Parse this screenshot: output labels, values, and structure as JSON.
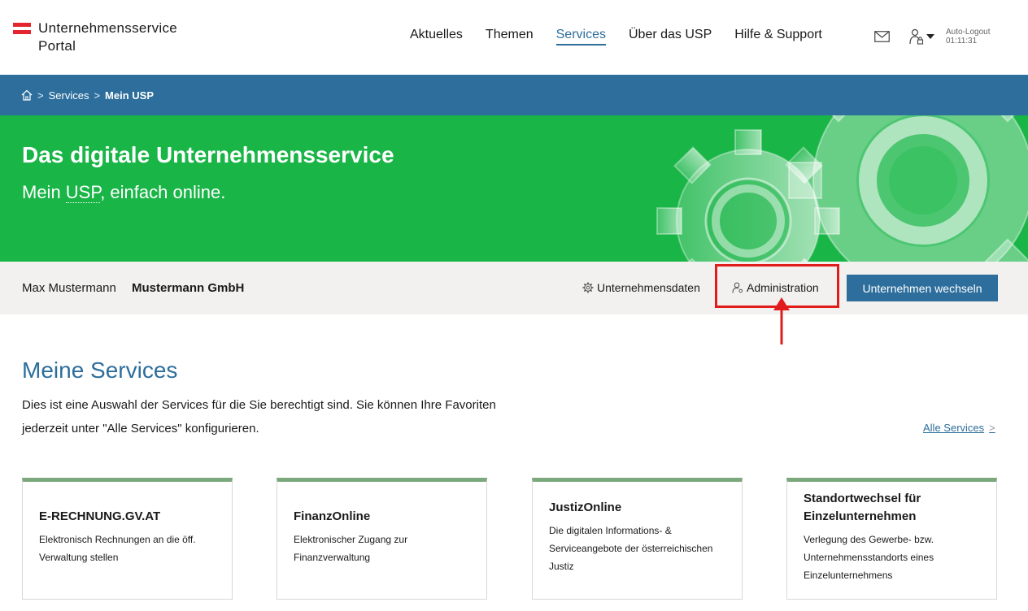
{
  "header": {
    "logo_line1": "Unternehmensservice",
    "logo_line2": "Portal",
    "nav": [
      "Aktuelles",
      "Themen",
      "Services",
      "Über das USP",
      "Hilfe & Support"
    ],
    "active_nav": "Services",
    "auto_logout_label": "Auto-Logout",
    "auto_logout_time": "01:11:31"
  },
  "breadcrumb": {
    "items": [
      "Services",
      "Mein USP"
    ]
  },
  "hero": {
    "title": "Das digitale Unternehmensservice",
    "subtitle_pre": "Mein ",
    "subtitle_abbr": "USP",
    "subtitle_post": ", einfach online."
  },
  "company_bar": {
    "user_name": "Max Mustermann",
    "company_name": "Mustermann GmbH",
    "company_data_link": "Unternehmensdaten",
    "admin_link": "Administration",
    "switch_button": "Unternehmen wechseln"
  },
  "services": {
    "title": "Meine Services",
    "description": "Dies ist eine Auswahl der Services für die Sie berechtigt sind. Sie können Ihre Favoriten jederzeit unter \"Alle Services\" konfigurieren.",
    "all_services_link": "Alle Services",
    "cards": [
      {
        "title": "E-RECHNUNG.GV.AT",
        "text": "Elektronisch Rechnungen an die öff. Verwaltung stellen"
      },
      {
        "title": "FinanzOnline",
        "text": "Elektronischer Zugang zur Finanzverwaltung"
      },
      {
        "title": "JustizOnline",
        "text": "Die digitalen Informations- & Serviceangebote der österreichischen Justiz"
      },
      {
        "title": "Standortwechsel für Einzelunternehmen",
        "text": "Verlegung des Gewerbe- bzw. Unternehmensstandorts eines Einzelunternehmens"
      }
    ]
  },
  "colors": {
    "primary": "#2d6e9c",
    "hero_green": "#19b547",
    "highlight_red": "#e01c1c",
    "card_accent": "#7ba87c"
  }
}
